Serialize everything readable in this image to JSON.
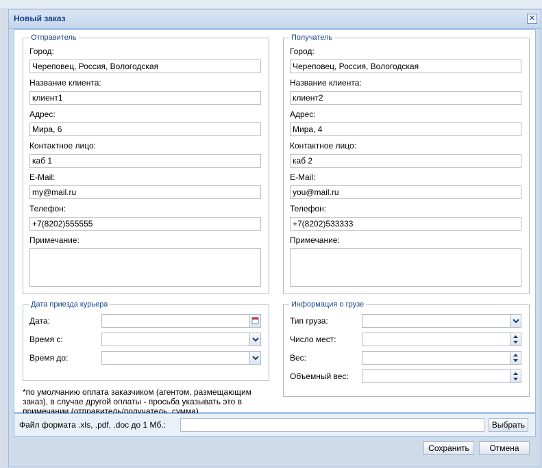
{
  "window": {
    "title": "Новый заказ",
    "close_glyph": "✕"
  },
  "sender": {
    "legend": "Отправитель",
    "city_label": "Город:",
    "city": "Череповец, Россия, Вологодская",
    "client_label": "Название клиента:",
    "client": "клиент1",
    "address_label": "Адрес:",
    "address": "Мира, 6",
    "contact_label": "Контактное лицо:",
    "contact": "каб 1",
    "email_label": "E-Mail:",
    "email": "my@mail.ru",
    "phone_label": "Телефон:",
    "phone": "+7(8202)555555",
    "note_label": "Примечание:",
    "note": ""
  },
  "recipient": {
    "legend": "Получатель",
    "city_label": "Город:",
    "city": "Череповец, Россия, Вологодская",
    "client_label": "Название клиента:",
    "client": "клиент2",
    "address_label": "Адрес:",
    "address": "Мира, 4",
    "contact_label": "Контактное лицо:",
    "contact": "каб 2",
    "email_label": "E-Mail:",
    "email": "you@mail.ru",
    "phone_label": "Телефон:",
    "phone": "+7(8202)533333",
    "note_label": "Примечание:",
    "note": ""
  },
  "courier": {
    "legend": "Дата приезда курьера",
    "date_label": "Дата:",
    "from_label": "Время с:",
    "to_label": "Время до:"
  },
  "cargo": {
    "legend": "Информация о грузе",
    "type_label": "Тип груза:",
    "seats_label": "Число мест:",
    "weight_label": "Вес:",
    "volume_label": "Объемный вес:"
  },
  "payment_note": "*по умолчанию оплата заказчиком (агентом, размещающим заказ), в случае другой оплаты - просьба указывать это в примечании (отправитель/получатель, сумма)",
  "file": {
    "label": "Файл формата .xls, .pdf, .doc до 1 Мб.:",
    "browse_label": "Выбрать"
  },
  "buttons": {
    "save": "Сохранить",
    "cancel": "Отмена"
  }
}
